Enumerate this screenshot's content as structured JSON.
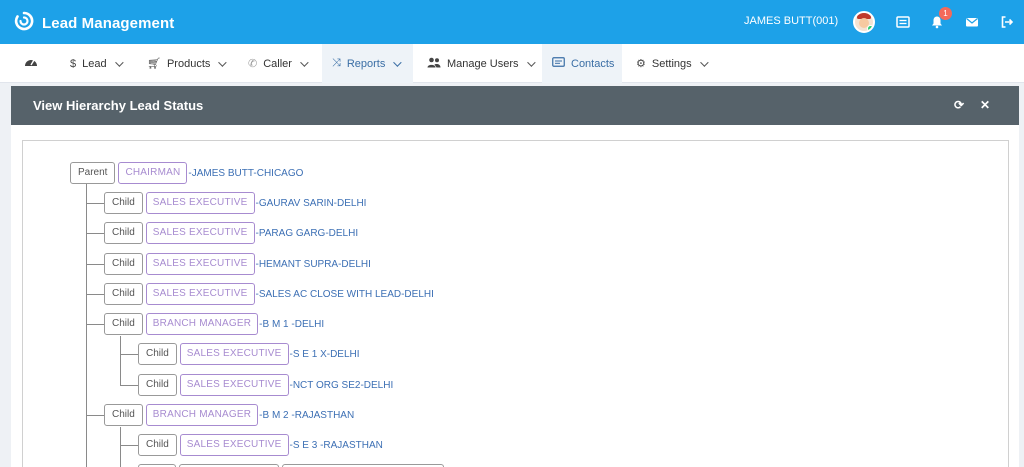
{
  "app": {
    "title": "Lead Management"
  },
  "header": {
    "user_name": "JAMES BUTT(001)",
    "notification_count": "1"
  },
  "menu": {
    "items": [
      {
        "label": "",
        "icon": "dashboard-icon"
      },
      {
        "label": "Lead",
        "icon": "dollar-icon"
      },
      {
        "label": "Products",
        "icon": "cart-icon"
      },
      {
        "label": "Caller",
        "icon": "phone-icon"
      },
      {
        "label": "Reports",
        "icon": "shuffle-icon",
        "active": true
      },
      {
        "label": "Manage Users",
        "icon": "users-icon"
      },
      {
        "label": "Contacts",
        "icon": "contact-card-icon",
        "active": true
      },
      {
        "label": "Settings",
        "icon": "gear-icon"
      }
    ]
  },
  "panel": {
    "title": "View Hierarchy Lead Status"
  },
  "tree": [
    {
      "type": "Parent",
      "role": "CHAIRMAN",
      "name": "-JAMES BUTT-CHICAGO",
      "level": 0
    },
    {
      "type": "Child",
      "role": "SALES EXECUTIVE",
      "name": "-GAURAV SARIN-DELHI",
      "level": 1
    },
    {
      "type": "Child",
      "role": "SALES EXECUTIVE",
      "name": "-PARAG GARG-DELHI",
      "level": 1
    },
    {
      "type": "Child",
      "role": "SALES EXECUTIVE",
      "name": "-HEMANT SUPRA-DELHI",
      "level": 1
    },
    {
      "type": "Child",
      "role": "SALES EXECUTIVE",
      "name": "-SALES AC CLOSE WITH LEAD-DELHI",
      "level": 1
    },
    {
      "type": "Child",
      "role": "BRANCH MANAGER",
      "name": "-B M 1 -DELHI",
      "level": 1
    },
    {
      "type": "Child",
      "role": "SALES EXECUTIVE",
      "name": "-S E 1 X-DELHI",
      "level": 2
    },
    {
      "type": "Child",
      "role": "SALES EXECUTIVE",
      "name": "-NCT ORG SE2-DELHI",
      "level": 2
    },
    {
      "type": "Child",
      "role": "BRANCH MANAGER",
      "name": "-B M 2 -RAJASTHAN",
      "level": 1
    },
    {
      "type": "Child",
      "role": "SALES EXECUTIVE",
      "name": "-S E 3 -RAJASTHAN",
      "level": 2
    }
  ]
}
